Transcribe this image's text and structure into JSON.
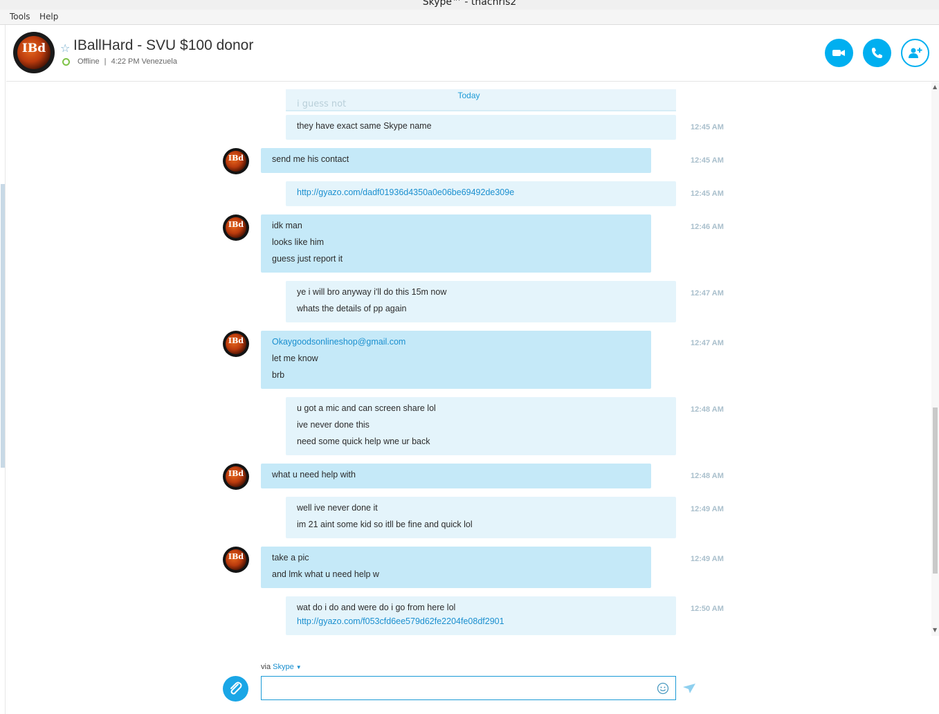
{
  "window": {
    "title": "Skype™ - thachris2"
  },
  "menu": {
    "items": [
      "Tools",
      "Help"
    ]
  },
  "header": {
    "avatar_text": "IBd",
    "contact_name": "IBallHard - SVU $100 donor",
    "status": "Offline",
    "separator": "|",
    "local_time": "4:22 PM Venezuela"
  },
  "chat": {
    "date_divider": "Today",
    "faded_text": "i guess not",
    "messages": [
      {
        "dir": "out",
        "time": "12:45 AM",
        "lines": [
          {
            "text": "they have exact same Skype name"
          }
        ]
      },
      {
        "dir": "in",
        "time": "12:45 AM",
        "lines": [
          {
            "text": "send me his contact"
          }
        ]
      },
      {
        "dir": "out",
        "time": "12:45 AM",
        "lines": [
          {
            "text": "http://gyazo.com/dadf01936d4350a0e06be69492de309e",
            "link": true
          }
        ]
      },
      {
        "dir": "in",
        "time": "12:46 AM",
        "lines": [
          {
            "text": "idk man"
          },
          {
            "text": "looks like him"
          },
          {
            "text": "guess just report it"
          }
        ]
      },
      {
        "dir": "out",
        "time": "12:47 AM",
        "lines": [
          {
            "text": "ye i will bro anyway i'll do this 15m now"
          },
          {
            "text": "whats the details of pp again"
          }
        ]
      },
      {
        "dir": "in",
        "time": "12:47 AM",
        "lines": [
          {
            "text": "Okaygoodsonlineshop@gmail.com",
            "link": true
          },
          {
            "text": "let me know"
          },
          {
            "text": "brb"
          }
        ]
      },
      {
        "dir": "out",
        "time": "12:48 AM",
        "lines": [
          {
            "text": "u got a mic and can screen share lol"
          },
          {
            "text": "ive never done this"
          },
          {
            "text": "need some quick help wne ur back"
          }
        ]
      },
      {
        "dir": "in",
        "time": "12:48 AM",
        "lines": [
          {
            "text": "what u need help with"
          }
        ]
      },
      {
        "dir": "out",
        "time": "12:49 AM",
        "lines": [
          {
            "text": "well ive never done it"
          },
          {
            "text": "im 21 aint some kid so itll be fine and quick lol"
          }
        ]
      },
      {
        "dir": "in",
        "time": "12:49 AM",
        "lines": [
          {
            "text": "take a pic"
          },
          {
            "text": "and lmk what u need help w"
          }
        ]
      },
      {
        "dir": "out",
        "time": "12:50 AM",
        "lines": [
          {
            "text": "wat do i do and were do i go from here lol"
          },
          {
            "text": "http://gyazo.com/f053cfd6ee579d62fe2204fe08df2901",
            "link": true
          }
        ]
      }
    ]
  },
  "composer": {
    "via": "via",
    "via_service": "Skype",
    "input_value": "",
    "input_placeholder": ""
  },
  "colors": {
    "accent": "#00aff0",
    "bubble_in": "#c5e9f8",
    "bubble_out": "#e4f4fb",
    "status_offline": "#7ec247"
  },
  "icons": [
    "star-icon",
    "video-call-icon",
    "phone-icon",
    "add-contact-icon",
    "attach-icon",
    "emoji-icon",
    "send-icon"
  ]
}
